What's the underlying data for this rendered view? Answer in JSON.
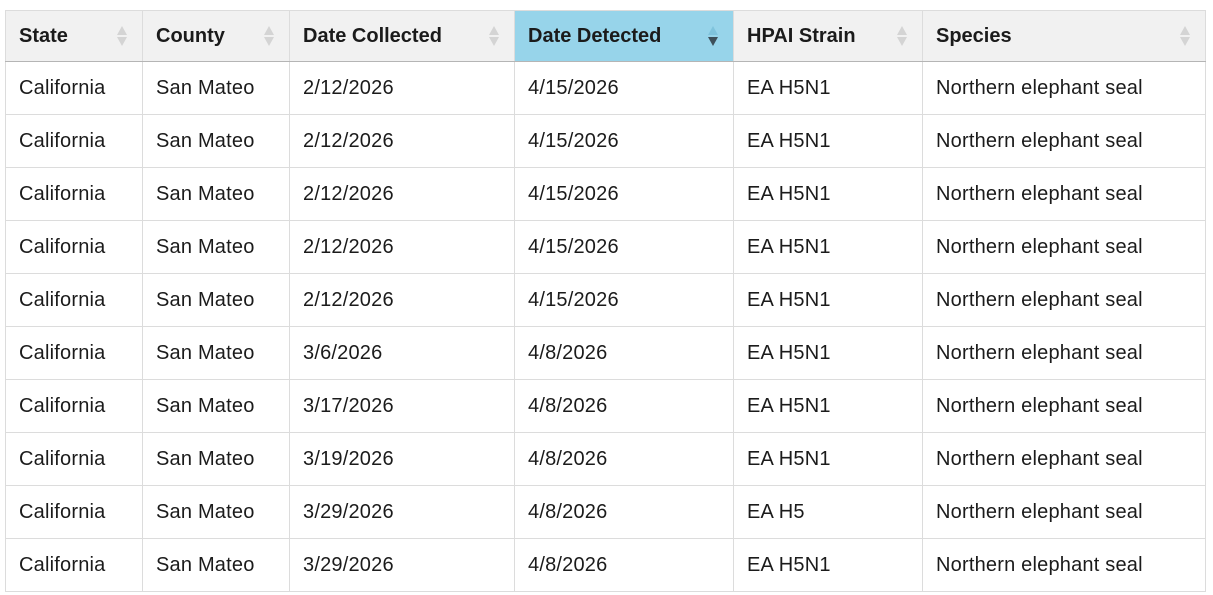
{
  "table": {
    "columns": [
      {
        "key": "state",
        "label": "State",
        "active": false
      },
      {
        "key": "county",
        "label": "County",
        "active": false
      },
      {
        "key": "date_collected",
        "label": "Date Collected",
        "active": false
      },
      {
        "key": "date_detected",
        "label": "Date Detected",
        "active": true
      },
      {
        "key": "hpai_strain",
        "label": "HPAI Strain",
        "active": false
      },
      {
        "key": "species",
        "label": "Species",
        "active": false
      }
    ],
    "rows": [
      [
        "California",
        "San Mateo",
        "2/12/2026",
        "4/15/2026",
        "EA H5N1",
        "Northern elephant seal"
      ],
      [
        "California",
        "San Mateo",
        "2/12/2026",
        "4/15/2026",
        "EA H5N1",
        "Northern elephant seal"
      ],
      [
        "California",
        "San Mateo",
        "2/12/2026",
        "4/15/2026",
        "EA H5N1",
        "Northern elephant seal"
      ],
      [
        "California",
        "San Mateo",
        "2/12/2026",
        "4/15/2026",
        "EA H5N1",
        "Northern elephant seal"
      ],
      [
        "California",
        "San Mateo",
        "2/12/2026",
        "4/15/2026",
        "EA H5N1",
        "Northern elephant seal"
      ],
      [
        "California",
        "San Mateo",
        "3/6/2026",
        "4/8/2026",
        "EA H5N1",
        "Northern elephant seal"
      ],
      [
        "California",
        "San Mateo",
        "3/17/2026",
        "4/8/2026",
        "EA H5N1",
        "Northern elephant seal"
      ],
      [
        "California",
        "San Mateo",
        "3/19/2026",
        "4/8/2026",
        "EA H5N1",
        "Northern elephant seal"
      ],
      [
        "California",
        "San Mateo",
        "3/29/2026",
        "4/8/2026",
        "EA H5",
        "Northern elephant seal"
      ],
      [
        "California",
        "San Mateo",
        "3/29/2026",
        "4/8/2026",
        "EA H5N1",
        "Northern elephant seal"
      ]
    ]
  },
  "icons": {
    "sort_unsorted": "sort-both-icon",
    "sort_descending": "sort-descending-icon"
  },
  "colors": {
    "active_header": "#97d4ea",
    "header_bg": "#f1f1f1",
    "sort_icon_inactive": "#d4d4d4",
    "sort_icon_active": "#3d4f5a"
  }
}
